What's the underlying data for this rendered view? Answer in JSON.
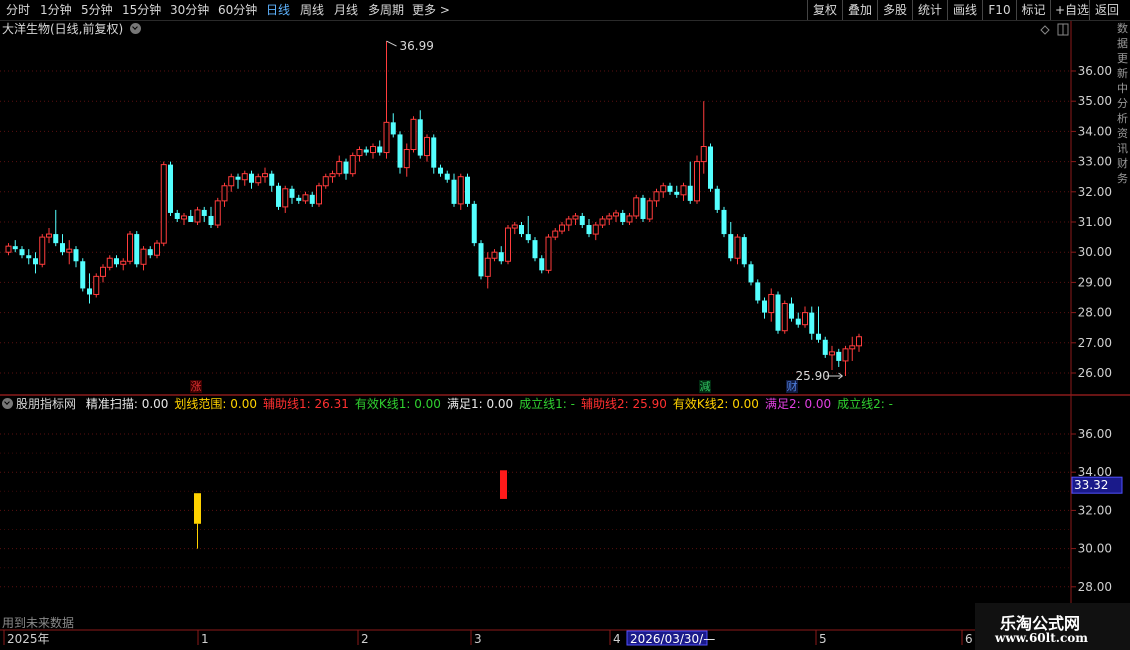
{
  "toolbar": {
    "periods": [
      "分时",
      "1分钟",
      "5分钟",
      "15分钟",
      "30分钟",
      "60分钟",
      "日线",
      "周线",
      "月线",
      "多周期",
      "更多 >"
    ],
    "active_period": "日线",
    "right_buttons": [
      "复权",
      "叠加",
      "多股",
      "统计",
      "画线",
      "F10",
      "标记",
      "+自选",
      "返回"
    ]
  },
  "chart_title": "大洋生物(日线,前复权)",
  "price_axis": [
    "36.00",
    "35.00",
    "34.00",
    "33.00",
    "32.00",
    "31.00",
    "30.00",
    "29.00",
    "28.00",
    "27.00",
    "26.00"
  ],
  "high_marker": "36.99",
  "low_marker": "25.90",
  "event_markers": [
    {
      "label": "涨",
      "color": "#e03030"
    },
    {
      "label": "減",
      "color": "#30c060"
    },
    {
      "label": "财",
      "color": "#5080e0"
    }
  ],
  "indicator": {
    "name": "股朋指标网",
    "items": [
      {
        "label": "精准扫描: 0.00",
        "color": "#e8e8e8"
      },
      {
        "label": "划线范围: 0.00",
        "color": "#ffd200"
      },
      {
        "label": "辅助线1: 26.31",
        "color": "#ff3030"
      },
      {
        "label": "有效K线1: 0.00",
        "color": "#30d030"
      },
      {
        "label": "满足1: 0.00",
        "color": "#e8e8e8"
      },
      {
        "label": "成立线1: -",
        "color": "#30d030"
      },
      {
        "label": "辅助线2: 25.90",
        "color": "#ff3030"
      },
      {
        "label": "有效K线2: 0.00",
        "color": "#ffd200"
      },
      {
        "label": "满足2: 0.00",
        "color": "#e040e0"
      },
      {
        "label": "成立线2: -",
        "color": "#30d030"
      }
    ],
    "axis": [
      "36.00",
      "34.00",
      "32.00",
      "30.00",
      "28.00"
    ],
    "current_value": "33.32"
  },
  "bottom_note": "用到未来数据",
  "time_axis": {
    "labels": [
      "2025年",
      "1",
      "2",
      "3",
      "4",
      "5",
      "6"
    ],
    "cursor_date": "2026/03/30/—"
  },
  "watermark": {
    "title": "乐淘公式网",
    "url": "www.60lt.com"
  },
  "right_strip_text": "数据更新中分析资讯财务"
}
